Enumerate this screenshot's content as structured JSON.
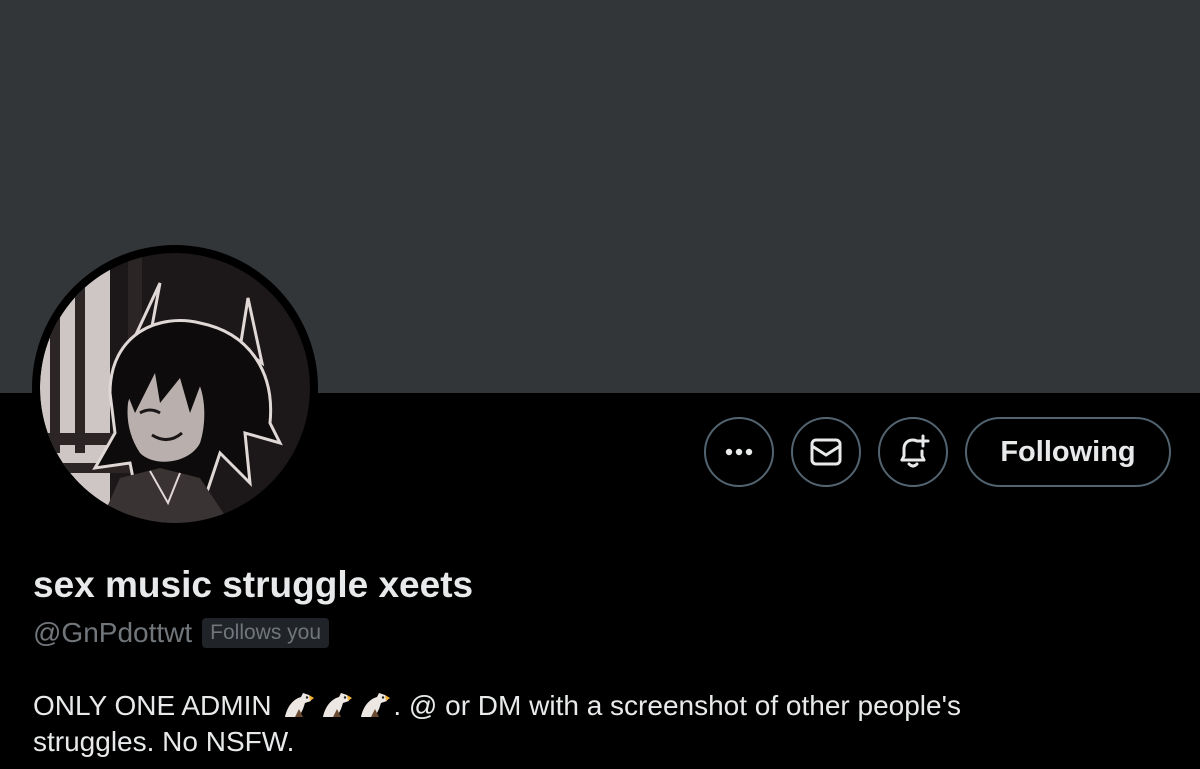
{
  "colors": {
    "banner": "#333639",
    "background": "#000000",
    "text_primary": "#e7e9ea",
    "text_secondary": "#71767b",
    "button_border": "#536471",
    "badge_bg": "#202327"
  },
  "actions": {
    "more_icon": "more-dots-icon",
    "message_icon": "envelope-icon",
    "notify_icon": "bell-plus-icon",
    "follow_label": "Following"
  },
  "profile": {
    "display_name": "sex music struggle xeets",
    "handle": "@GnPdottwt",
    "follows_you": "Follows you",
    "bio_part1": "ONLY ONE ADMIN",
    "bio_emoji": "eagle-emoji",
    "bio_part2": ". @ or DM with a screenshot of other people's",
    "bio_line2": "struggles. No NSFW."
  }
}
